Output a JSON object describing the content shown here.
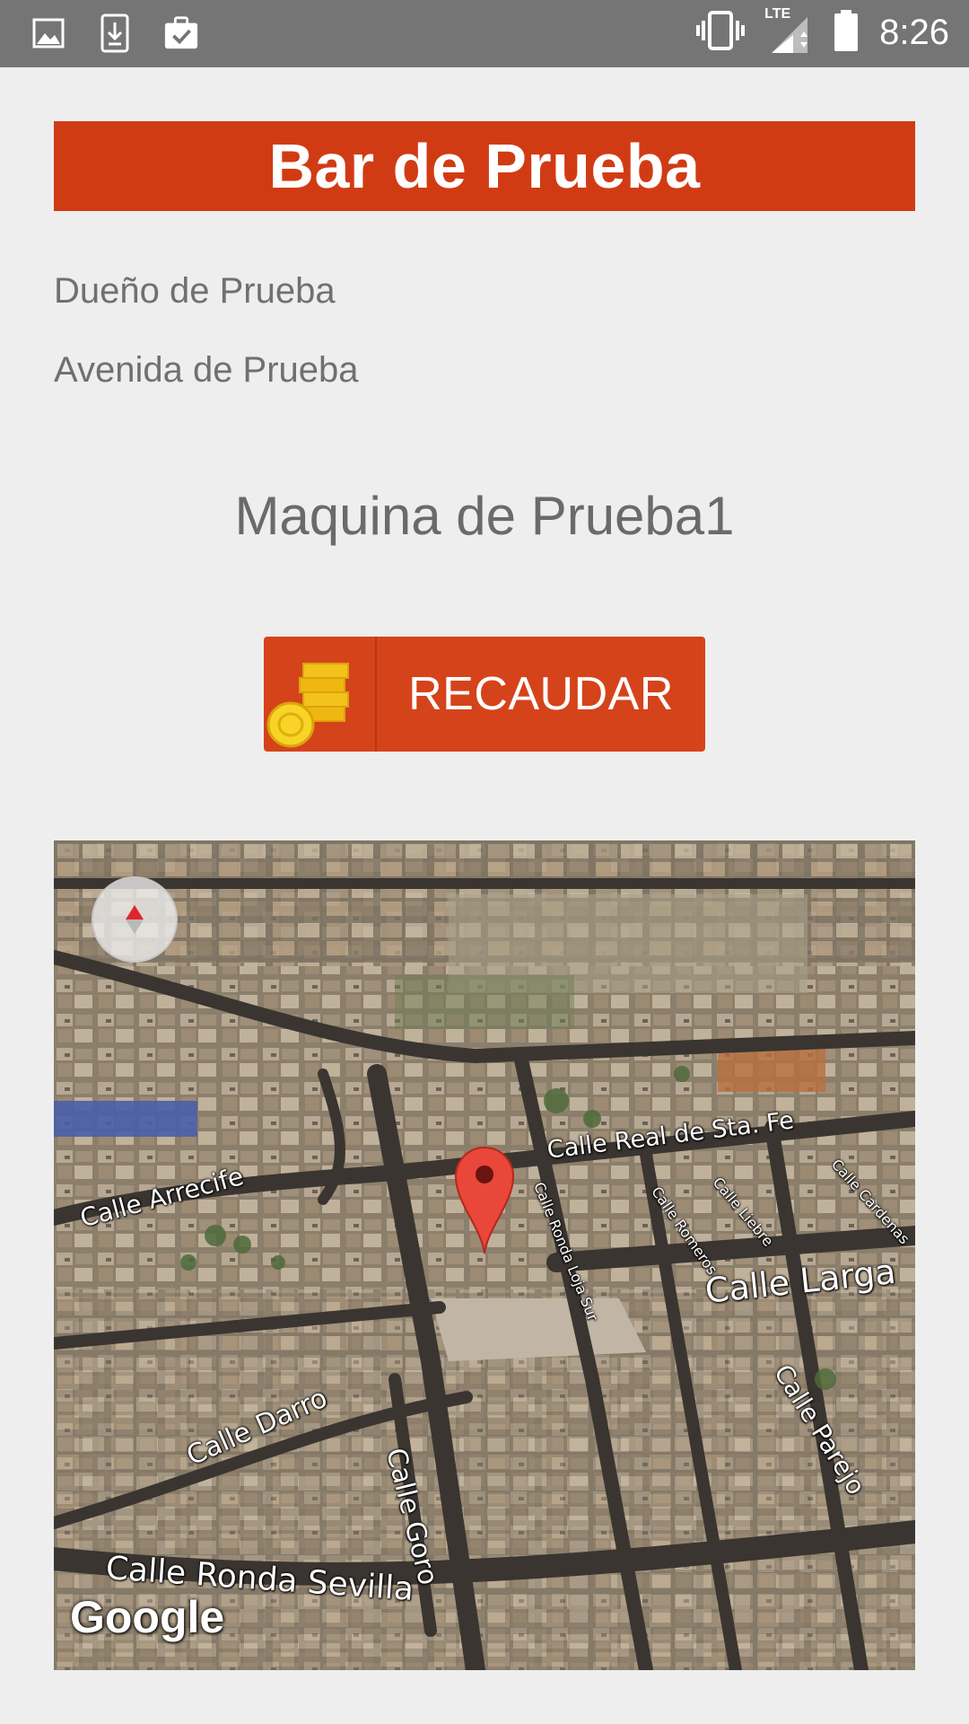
{
  "status_bar": {
    "time": "8:26",
    "network_label": "LTE",
    "icons": [
      "image-icon",
      "download-icon",
      "clipboard-check-icon",
      "vibrate-icon",
      "signal-icon",
      "battery-icon"
    ]
  },
  "header": {
    "title": "Bar de Prueba",
    "color": "#d13b14"
  },
  "details": {
    "owner": "Dueño de Prueba",
    "address": "Avenida de Prueba"
  },
  "machine": {
    "name": "Maquina de Prueba1"
  },
  "action_button": {
    "label": "RECAUDAR",
    "icon": "coins-icon",
    "color": "#d5431b"
  },
  "map": {
    "attribution": "Google",
    "view": "satellite",
    "streets": [
      "Calle Real de Sta. Fe",
      "Calle Arrecife",
      "Calle Ronda Loja Sur",
      "Calle Romeros",
      "Calle Liebre",
      "Calle Cardenas",
      "Calle Larga",
      "Calle Parejo",
      "Calle Darro",
      "Calle Goro",
      "Calle Ronda Sevilla"
    ]
  }
}
